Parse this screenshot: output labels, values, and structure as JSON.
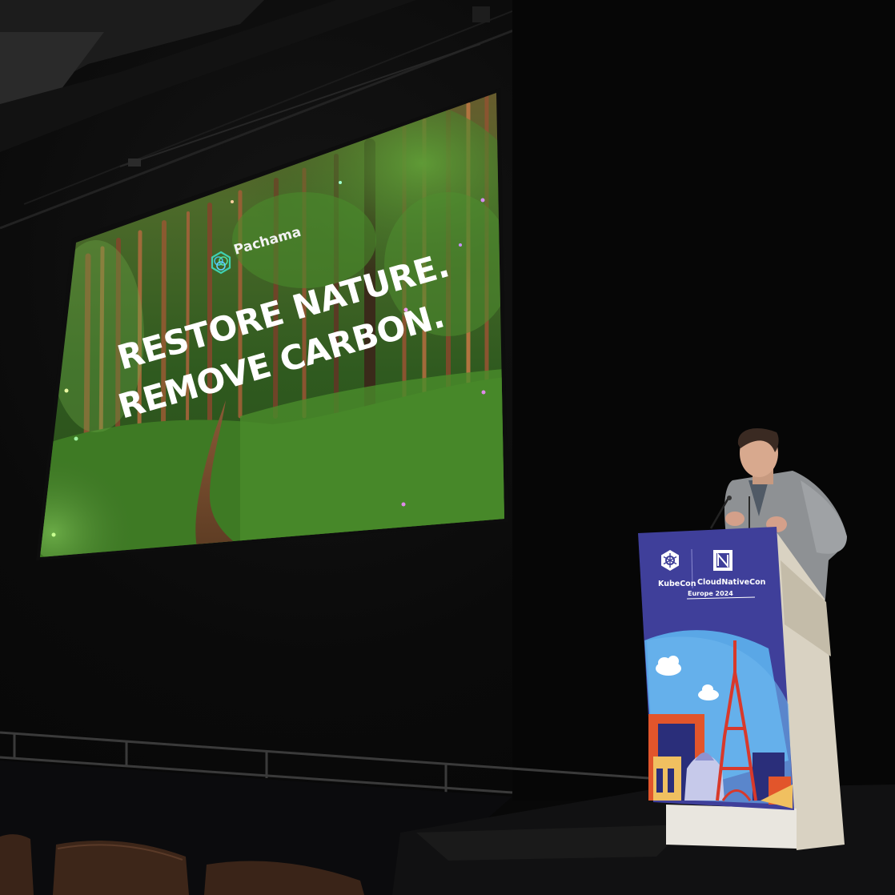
{
  "slide": {
    "brand": "Pachama",
    "headline_line1": "RESTORE NATURE.",
    "headline_line2": "REMOVE CARBON."
  },
  "podium": {
    "left_brand": "KubeCon",
    "right_brand": "CloudNativeCon",
    "edition": "Europe 2024"
  },
  "colors": {
    "forest_dark": "#1f3a17",
    "forest_mid": "#3f7a2a",
    "forest_light": "#7fb84a",
    "podium_purple": "#3f3f9a",
    "sky_blue": "#5aa7e6",
    "eiffel_red": "#d8392b"
  },
  "icons": [
    "pachama-logo-icon",
    "kubernetes-helm-icon",
    "cncf-icon",
    "cloud-icon",
    "eiffel-tower-icon"
  ]
}
